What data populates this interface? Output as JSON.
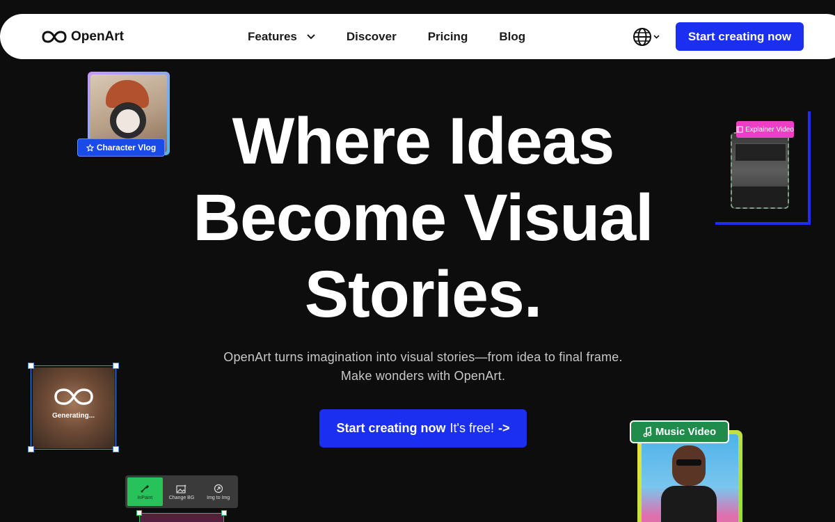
{
  "nav": {
    "brand": "OpenArt",
    "links": [
      {
        "label": "Features"
      },
      {
        "label": "Discover"
      },
      {
        "label": "Pricing"
      },
      {
        "label": "Blog"
      }
    ],
    "cta": "Start creating now"
  },
  "hero": {
    "title_lines": [
      "Where Ideas",
      "Become Visual",
      "Stories."
    ],
    "subtitle_lines": [
      "OpenArt turns imagination into visual stories—from idea to final frame.",
      "Make wonders with OpenArt."
    ],
    "cta_main": "Start creating now",
    "cta_free": "It's free!",
    "cta_arrow": "->"
  },
  "cards": {
    "vlog_badge": "Character Vlog",
    "explainer_badge": "Explainer Video",
    "generating": "Generating...",
    "music_badge": "Music Video",
    "tools": [
      "InPaint",
      "Change BG",
      "Img to Img"
    ]
  },
  "colors": {
    "accent": "#1a2ff0",
    "background": "#0d0d0d",
    "music_badge": "#1f8c4c",
    "explainer_badge": "#ec3fc4",
    "inpaint_active": "#27c25a"
  }
}
